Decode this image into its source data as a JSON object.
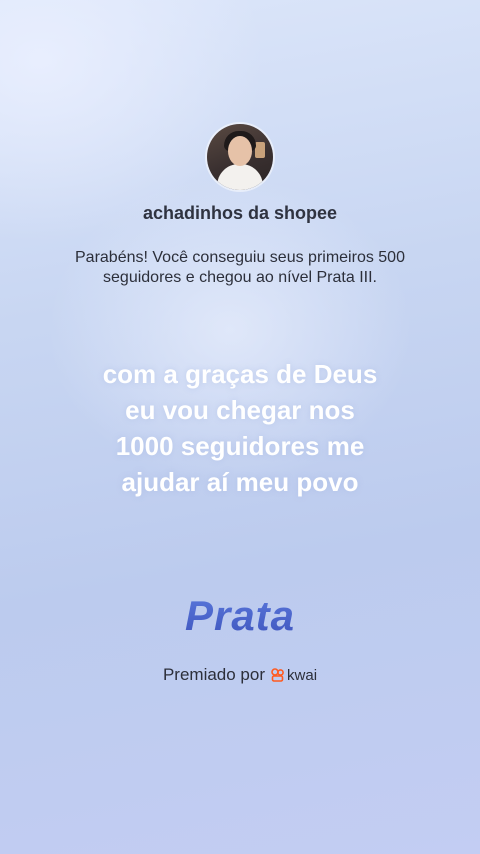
{
  "profile": {
    "username": "achadinhos da shopee"
  },
  "achievement": {
    "message_line1": "Parabéns! Você conseguiu seus primeiros 500",
    "message_line2": "seguidores e chegou ao nível Prata III.",
    "level_name": "Prata"
  },
  "post": {
    "lines": [
      "com a graças de Deus",
      "eu vou chegar nos",
      "1000 seguidores me",
      "ajudar aí meu povo"
    ]
  },
  "footer": {
    "awarded_label": "Premiado por",
    "brand_icon": "kwai-logo-icon",
    "brand_name": "kwai",
    "brand_color": "#ff5a1f"
  },
  "colors": {
    "level_text": "#4b62c9",
    "quote_text": "#ffffff"
  }
}
